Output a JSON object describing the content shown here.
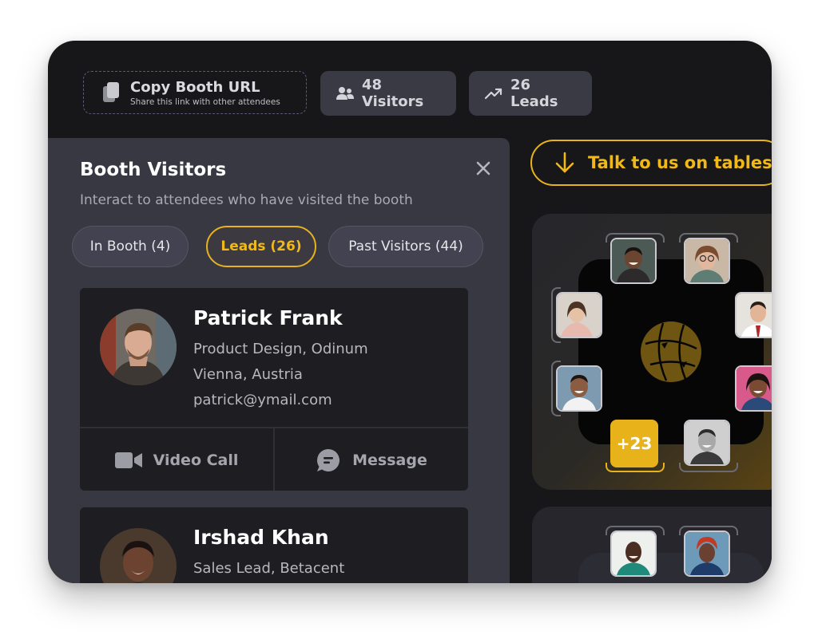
{
  "topbar": {
    "copy_url": {
      "title": "Copy Booth URL",
      "subtitle": "Share this link with other attendees",
      "icon": "copy-icon"
    },
    "visitors": {
      "label": "48 Visitors",
      "icon": "users-icon"
    },
    "leads": {
      "label": "26 Leads",
      "icon": "trend-up-icon"
    }
  },
  "panel": {
    "title": "Booth Visitors",
    "subtitle": "Interact to attendees who have visited the booth",
    "tabs": [
      {
        "label": "In Booth (4)",
        "active": false
      },
      {
        "label": "Leads (26)",
        "active": true
      },
      {
        "label": "Past Visitors (44)",
        "active": false
      }
    ],
    "people": [
      {
        "name": "Patrick Frank",
        "role": "Product Design, Odinum",
        "location": "Vienna, Austria",
        "email": "patrick@ymail.com"
      },
      {
        "name": "Irshad Khan",
        "role": "Sales Lead, Betacent"
      }
    ],
    "actions": {
      "video_call": "Video Call",
      "message": "Message"
    }
  },
  "table_area": {
    "talk_button": "Talk to us on tables",
    "more_count": "+23"
  },
  "colors": {
    "accent": "#e8b21a",
    "background": "#171719",
    "panel": "#383842",
    "card": "#1d1d22"
  }
}
